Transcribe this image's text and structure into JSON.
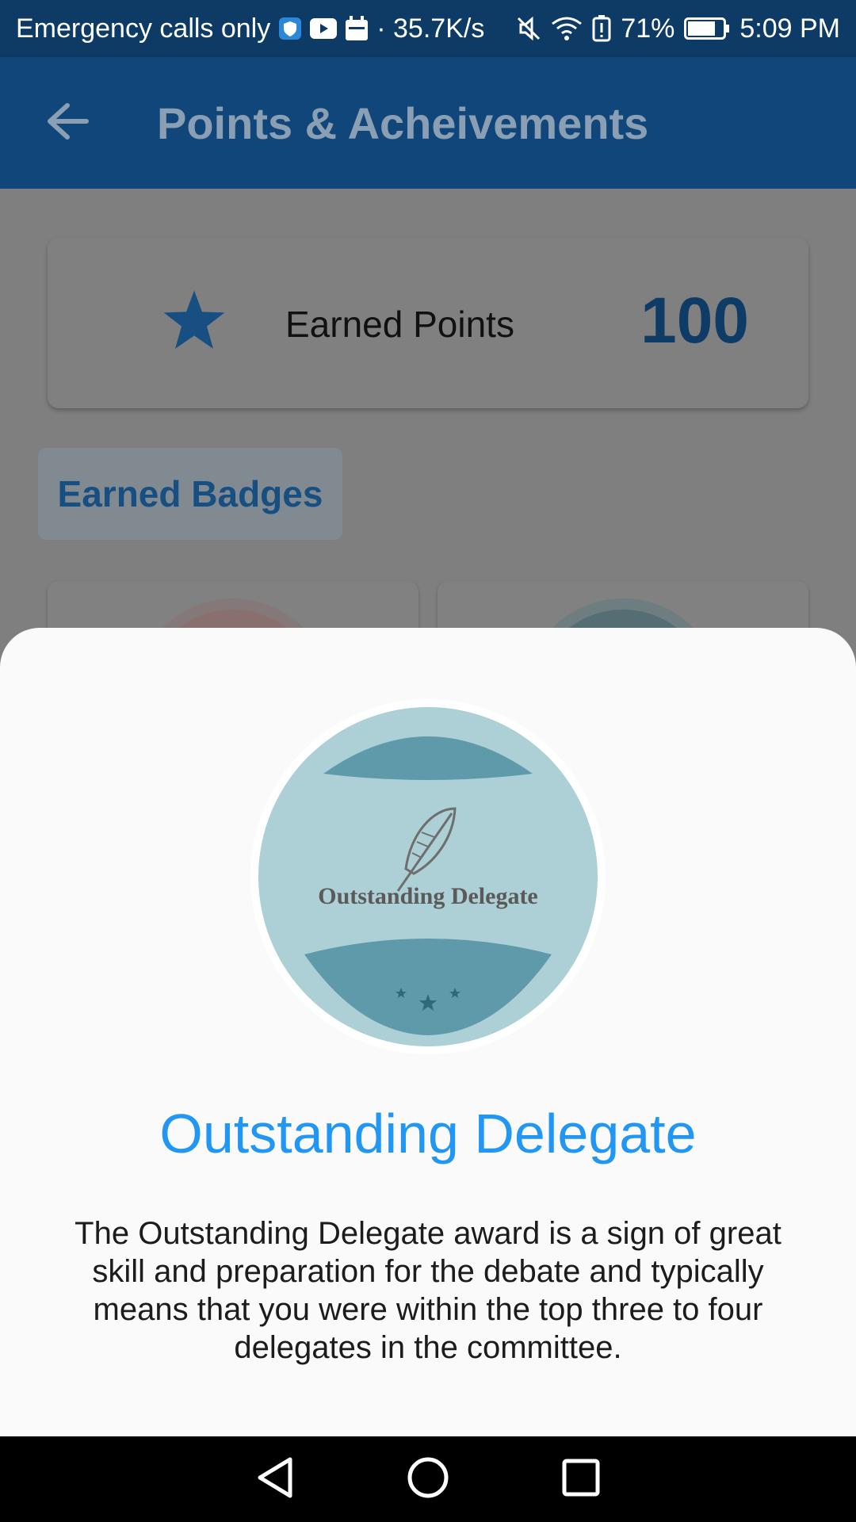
{
  "status_bar": {
    "carrier": "Emergency calls only",
    "speed": "· 35.7K/s",
    "battery": "71%",
    "time": "5:09 PM"
  },
  "app_bar": {
    "title": "Points & Acheivements"
  },
  "points_card": {
    "label": "Earned Points",
    "value": "100"
  },
  "badges_tab": {
    "label": "Earned Badges"
  },
  "sheet": {
    "badge_text": "Outstanding Delegate",
    "title": "Outstanding Delegate",
    "description": "The Outstanding Delegate award is a sign of great skill and preparation for the debate and typically means that you were within the top three to four delegates in the committee."
  },
  "colors": {
    "app_bar": "#11467a",
    "accent": "#2196f3",
    "badge_light": "#adcfd6",
    "badge_dark": "#5f9aab"
  }
}
